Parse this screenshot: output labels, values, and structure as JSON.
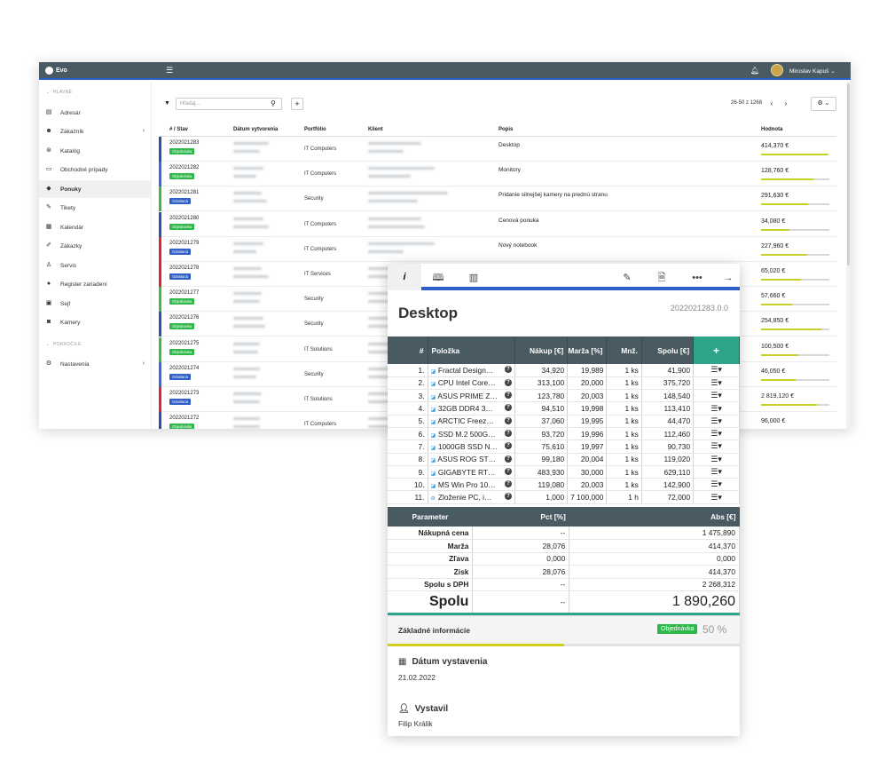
{
  "app": {
    "name": "Evo",
    "user": "Miroslav Kapuš"
  },
  "sidebar": {
    "section_main": "HLAVNÉ",
    "section_advanced": "POKROČILÉ",
    "items": [
      {
        "label": "Adresár",
        "icon": "address-book-icon"
      },
      {
        "label": "Zákazník",
        "icon": "users-icon"
      },
      {
        "label": "Katalóg",
        "icon": "catalog-icon"
      },
      {
        "label": "Obchodné prípady",
        "icon": "book-icon"
      },
      {
        "label": "Ponuky",
        "icon": "tags-icon"
      },
      {
        "label": "Tikety",
        "icon": "ticket-icon"
      },
      {
        "label": "Kalendár",
        "icon": "calendar-icon"
      },
      {
        "label": "Zákazky",
        "icon": "edit-icon"
      },
      {
        "label": "Servis",
        "icon": "sitemap-icon"
      },
      {
        "label": "Register zariadení",
        "icon": "device-icon"
      },
      {
        "label": "Sejf",
        "icon": "safe-icon"
      },
      {
        "label": "Kamery",
        "icon": "camera-icon"
      },
      {
        "label": "Nastavenia",
        "icon": "settings-icon"
      }
    ]
  },
  "toolbar": {
    "search_placeholder": "Hľadaj...",
    "pager": "26-50 z 1268"
  },
  "table": {
    "columns": [
      "# / Stav",
      "Dátum vytvorenia",
      "Portfólio",
      "Klient",
      "Popis",
      "Hodnota"
    ],
    "rows": [
      {
        "num": "2022021283",
        "status": "Objednávka",
        "portfolio": "IT Computers",
        "popis": "Desktop",
        "value": "414,370 €"
      },
      {
        "num": "2022021282",
        "status": "Objednávka",
        "portfolio": "IT Computers",
        "popis": "Monitory",
        "value": "128,760 €"
      },
      {
        "num": "2022021281",
        "status": "Odoslaná",
        "portfolio": "Security",
        "popis": "Pridanie silnejšej kamery na prednú stranu",
        "value": "291,630 €"
      },
      {
        "num": "2022021280",
        "status": "Objednávka",
        "portfolio": "IT Computers",
        "popis": "Cenová ponuka",
        "value": "34,080 €"
      },
      {
        "num": "2022021279",
        "status": "Odoslaná",
        "portfolio": "IT Computers",
        "popis": "Nový notebook",
        "value": "227,960 €"
      },
      {
        "num": "2022021278",
        "status": "Odoslaná",
        "portfolio": "IT Services",
        "popis": "",
        "value": "65,020 €"
      },
      {
        "num": "2022021277",
        "status": "Objednávka",
        "portfolio": "Security",
        "popis": "",
        "value": "57,660 €"
      },
      {
        "num": "2022021276",
        "status": "Objednávka",
        "portfolio": "Security",
        "popis": "",
        "value": "254,850 €"
      },
      {
        "num": "2022021275",
        "status": "Objednávka",
        "portfolio": "IT Solutions",
        "popis": "",
        "value": "100,500 €"
      },
      {
        "num": "2022021274",
        "status": "Odoslaná",
        "portfolio": "Security",
        "popis": "",
        "value": "46,050 €"
      },
      {
        "num": "2022021273",
        "status": "Odoslaná",
        "portfolio": "IT Solutions",
        "popis": "",
        "value": "2 819,120 €"
      },
      {
        "num": "2022021272",
        "status": "Objednávka",
        "portfolio": "IT Computers",
        "popis": "",
        "value": "96,000 €"
      }
    ]
  },
  "panel": {
    "title": "Desktop",
    "code": "2022021283.0.0",
    "items_columns": [
      "#",
      "Položka",
      "Nákup [€]",
      "Marža [%]",
      "Mnž.",
      "Spolu [€]",
      "+"
    ],
    "items": [
      {
        "n": "1.",
        "name": "Fractal Design…",
        "nakup": "34,920",
        "marza": "19,989",
        "mnz": "1 ks",
        "spolu": "41,900"
      },
      {
        "n": "2.",
        "name": "CPU Intel Core…",
        "nakup": "313,100",
        "marza": "20,000",
        "mnz": "1 ks",
        "spolu": "375,720"
      },
      {
        "n": "3.",
        "name": "ASUS PRIME Z…",
        "nakup": "123,780",
        "marza": "20,003",
        "mnz": "1 ks",
        "spolu": "148,540"
      },
      {
        "n": "4.",
        "name": "32GB DDR4 3…",
        "nakup": "94,510",
        "marza": "19,998",
        "mnz": "1 ks",
        "spolu": "113,410"
      },
      {
        "n": "5.",
        "name": "ARCTIC Freez…",
        "nakup": "37,060",
        "marza": "19,995",
        "mnz": "1 ks",
        "spolu": "44,470"
      },
      {
        "n": "6.",
        "name": "SSD M.2 500G…",
        "nakup": "93,720",
        "marza": "19,996",
        "mnz": "1 ks",
        "spolu": "112,460"
      },
      {
        "n": "7.",
        "name": "1000GB SSD N…",
        "nakup": "75,610",
        "marza": "19,997",
        "mnz": "1 ks",
        "spolu": "90,730"
      },
      {
        "n": "8.",
        "name": "ASUS ROG ST…",
        "nakup": "99,180",
        "marza": "20,004",
        "mnz": "1 ks",
        "spolu": "119,020"
      },
      {
        "n": "9.",
        "name": "GIGABYTE RT…",
        "nakup": "483,930",
        "marza": "30,000",
        "mnz": "1 ks",
        "spolu": "629,110"
      },
      {
        "n": "10.",
        "name": "MS Win Pro 10…",
        "nakup": "119,080",
        "marza": "20,003",
        "mnz": "1 ks",
        "spolu": "142,900"
      },
      {
        "n": "11.",
        "name": "Zloženie PC, i…",
        "nakup": "1,000",
        "marza": "7 100,000",
        "mnz": "1 h",
        "spolu": "72,000"
      }
    ],
    "summary_columns": [
      "Parameter",
      "Pct [%]",
      "Abs [€]"
    ],
    "summary": [
      {
        "label": "Nákupná cena",
        "pct": "--",
        "abs": "1 475,890"
      },
      {
        "label": "Marža",
        "pct": "28,076",
        "abs": "414,370"
      },
      {
        "label": "Zľava",
        "pct": "0,000",
        "abs": "0,000"
      },
      {
        "label": "Zisk",
        "pct": "28,076",
        "abs": "414,370"
      },
      {
        "label": "Spolu s DPH",
        "pct": "--",
        "abs": "2 268,312"
      }
    ],
    "total": {
      "label": "Spolu",
      "pct": "--",
      "abs": "1 890,260"
    },
    "basic_info": {
      "title": "Základné informácie",
      "status": "Objednávka",
      "progress": "50 %",
      "progress_fraction": 0.5
    },
    "fields": {
      "date_label": "Dátum vystavenia",
      "date_value": "21.02.2022",
      "author_label": "Vystavil",
      "author_value": "Filip Králik"
    }
  },
  "colors": {
    "header": "#4a5a63",
    "accent_blue": "#2e5fc7",
    "accent_green": "#2ea58a",
    "status_order": "#2eb84a",
    "status_sent": "#2e5fc7",
    "value_bar": "#c8cf28"
  }
}
